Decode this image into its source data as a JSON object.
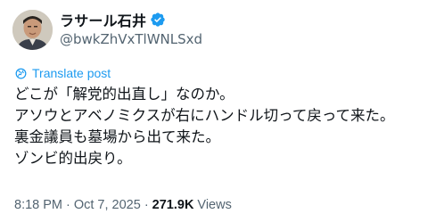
{
  "author": {
    "display_name": "ラサール石井",
    "handle": "@bwkZhVxTlWNLSxd",
    "verified": true
  },
  "translate_label": "Translate post",
  "post_lines": [
    "どこが「解党的出直し」なのか。",
    "アソウとアベノミクスが右にハンドル切って戻って来た。",
    "裏金議員も墓場から出て来た。",
    "ゾンビ的出戻り。"
  ],
  "meta": {
    "time": "8:18 PM",
    "separator": "·",
    "date": "Oct 7, 2025",
    "views_count": "271.9K",
    "views_label": "Views"
  },
  "colors": {
    "accent": "#1d9bf0",
    "secondary_text": "#536471",
    "primary_text": "#0f1419"
  },
  "icons": {
    "verified": "verified-badge-icon",
    "translate": "globe-icon"
  }
}
